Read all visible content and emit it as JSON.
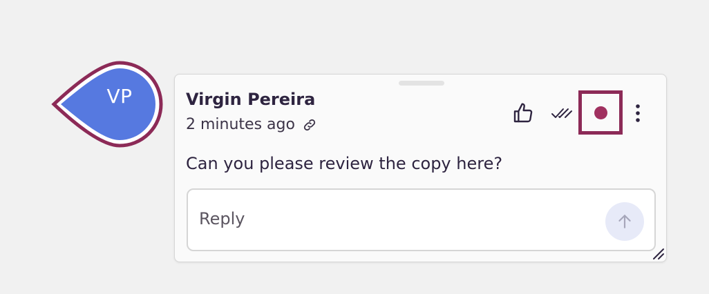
{
  "avatar": {
    "initials": "VP",
    "fill_color": "#5679e0",
    "ring_color": "#8c2a57"
  },
  "comment": {
    "author": "Virgin Pereira",
    "timestamp": "2 minutes ago",
    "body": "Can you please review the copy here?"
  },
  "actions": {
    "like_icon": "thumbs-up-icon",
    "resolve_icon": "double-check-icon",
    "record_icon": "record-dot-icon",
    "more_icon": "more-vertical-icon",
    "highlight_color": "#8c2a57"
  },
  "reply": {
    "placeholder": "Reply",
    "value": "",
    "send_icon": "arrow-up-icon"
  }
}
